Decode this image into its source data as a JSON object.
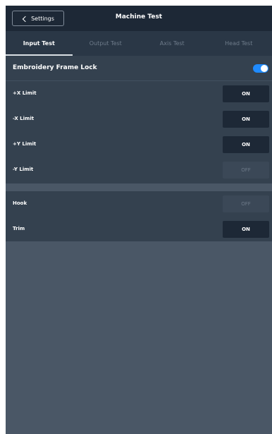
{
  "header": {
    "back_label": "Settings",
    "title": "Machine Test"
  },
  "tabs": [
    {
      "label": "Input Test",
      "active": true
    },
    {
      "label": "Output Test",
      "active": false
    },
    {
      "label": "Axis Test",
      "active": false
    },
    {
      "label": "Head Test",
      "active": false
    }
  ],
  "frame_lock": {
    "label": "Embroidery Frame Lock",
    "enabled": true
  },
  "limits": [
    {
      "label": "+X Limit",
      "state": "ON"
    },
    {
      "label": "-X Limit",
      "state": "ON"
    },
    {
      "label": "+Y Limit",
      "state": "ON"
    },
    {
      "label": "-Y Limit",
      "state": "OFF"
    }
  ],
  "others": [
    {
      "label": "Hook",
      "state": "OFF"
    },
    {
      "label": "Trim",
      "state": "ON"
    }
  ],
  "colors": {
    "accent": "#1f8bff",
    "header_bg": "#1d2836",
    "tab_bg": "#2a3746",
    "row_bg": "#34414f",
    "page_bg": "#4a5766"
  }
}
